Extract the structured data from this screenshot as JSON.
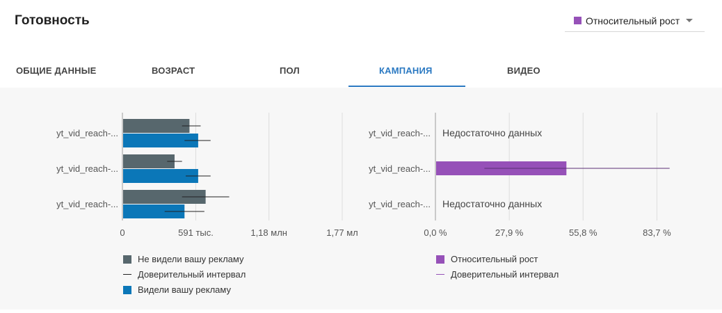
{
  "title": "Готовность",
  "metric_select": {
    "label": "Относительный рост",
    "color": "#9651b8"
  },
  "tabs": [
    {
      "label": "ОБЩИЕ ДАННЫЕ",
      "active": false
    },
    {
      "label": "ВОЗРАСТ",
      "active": false
    },
    {
      "label": "ПОЛ",
      "active": false
    },
    {
      "label": "КАМПАНИЯ",
      "active": true
    },
    {
      "label": "ВИДЕО",
      "active": false
    }
  ],
  "colors": {
    "not_seen": "#57676d",
    "seen": "#0b77b8",
    "lift": "#9651b8",
    "ci": "#222222",
    "grid": "#dddddd",
    "axis_text": "#555555"
  },
  "chart_data": [
    {
      "type": "bar",
      "orientation": "horizontal",
      "categories": [
        "yt_vid_reach-...",
        "yt_vid_reach-...",
        "yt_vid_reach-..."
      ],
      "series": [
        {
          "name": "Не видели вашу рекламу",
          "values": [
            540000,
            420000,
            670000
          ],
          "ci": [
            [
              480000,
              630000
            ],
            [
              360000,
              480000
            ],
            [
              480000,
              860000
            ]
          ]
        },
        {
          "name": "Видели вашу рекламу",
          "values": [
            610000,
            610000,
            500000
          ],
          "ci": [
            [
              500000,
              710000
            ],
            [
              510000,
              710000
            ],
            [
              340000,
              660000
            ]
          ]
        }
      ],
      "xlim": [
        0,
        1770000
      ],
      "xticks": [
        0,
        591000,
        1180000,
        1770000
      ],
      "xtick_labels": [
        "0",
        "591 тыс.",
        "1,18 млн",
        "1,77 мл"
      ],
      "legend": [
        "Не видели вашу рекламу",
        "Доверительный интервал",
        "Видели вашу рекламу"
      ],
      "grid": true
    },
    {
      "type": "bar",
      "orientation": "horizontal",
      "categories": [
        "yt_vid_reach-...",
        "yt_vid_reach-...",
        "yt_vid_reach-..."
      ],
      "series": [
        {
          "name": "Относительный рост",
          "values": [
            null,
            49.5,
            null
          ],
          "ci": [
            null,
            [
              18.5,
              88.5
            ],
            null
          ]
        }
      ],
      "annotations": [
        "Недостаточно данных",
        "",
        "Недостаточно данных"
      ],
      "xlim": [
        0,
        92
      ],
      "xticks": [
        0,
        27.9,
        55.8,
        83.7
      ],
      "xtick_labels": [
        "0,0 %",
        "27,9 %",
        "55,8 %",
        "83,7 %"
      ],
      "legend": [
        "Относительный рост",
        "Доверительный интервал"
      ],
      "grid": true
    }
  ]
}
